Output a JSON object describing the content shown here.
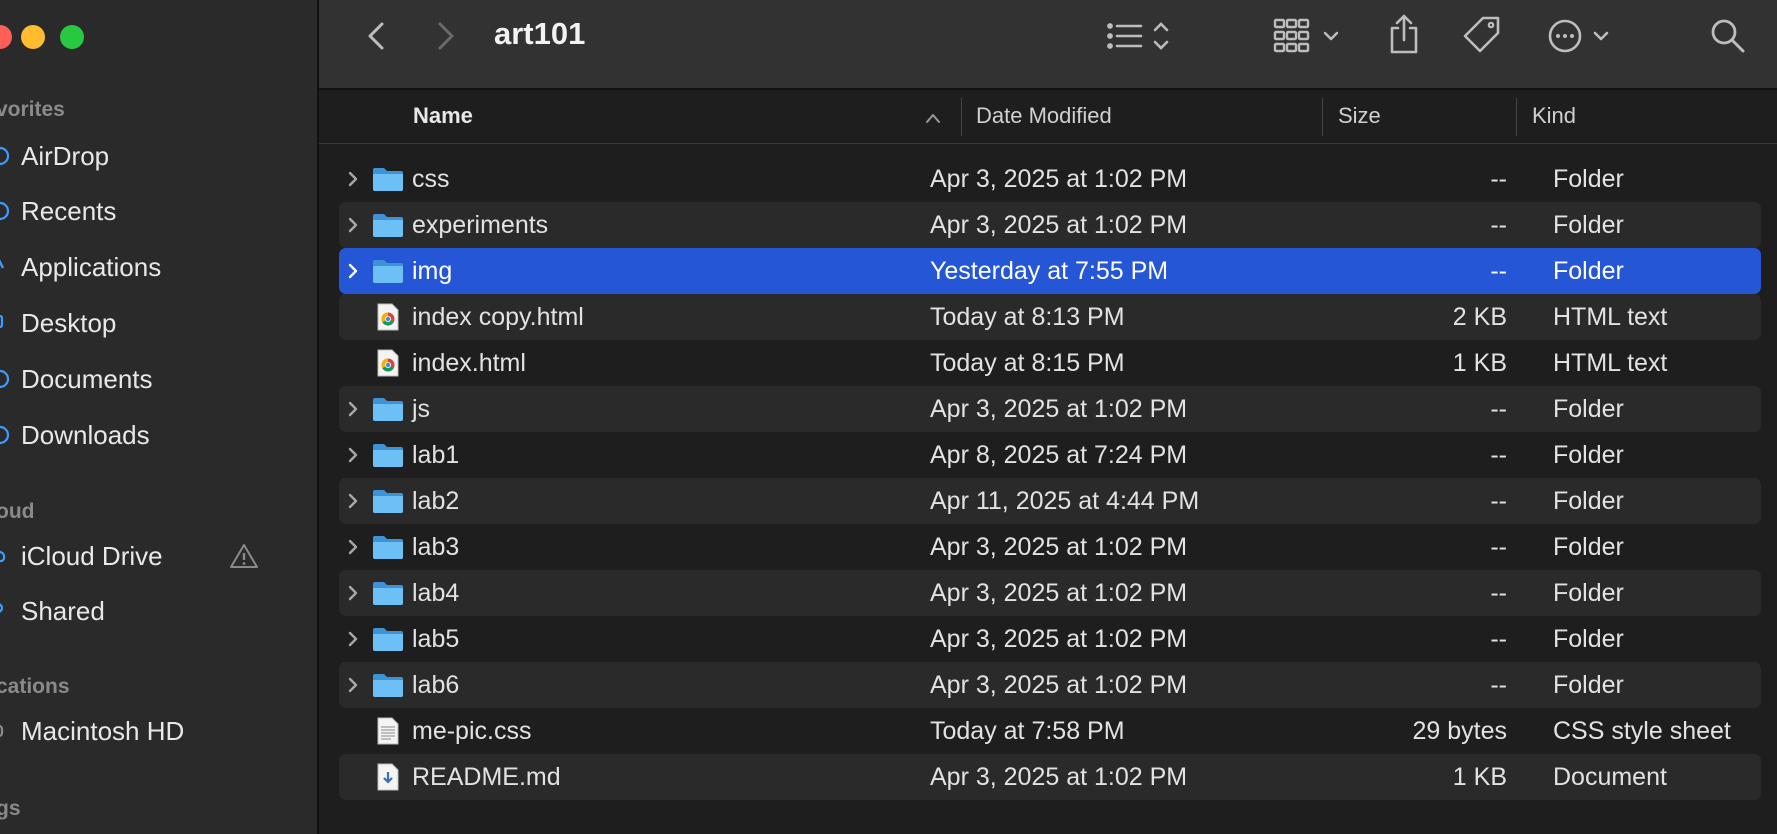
{
  "window": {
    "title": "art101"
  },
  "sidebar": {
    "sections": [
      {
        "label": "vorites",
        "items": [
          {
            "label": "AirDrop",
            "icon": "airdrop-icon"
          },
          {
            "label": "Recents",
            "icon": "clock-icon"
          },
          {
            "label": "Applications",
            "icon": "applications-icon"
          },
          {
            "label": "Desktop",
            "icon": "desktop-icon"
          },
          {
            "label": "Documents",
            "icon": "document-icon"
          },
          {
            "label": "Downloads",
            "icon": "download-icon"
          }
        ]
      },
      {
        "label": "oud",
        "items": [
          {
            "label": "iCloud Drive",
            "icon": "cloud-icon"
          },
          {
            "label": "Shared",
            "icon": "shared-folder-icon"
          }
        ]
      },
      {
        "label": "cations",
        "items": [
          {
            "label": "Macintosh HD",
            "icon": "drive-icon"
          }
        ]
      },
      {
        "label": "gs",
        "items": []
      }
    ]
  },
  "table": {
    "columns": {
      "name": "Name",
      "date": "Date Modified",
      "size": "Size",
      "kind": "Kind"
    },
    "sort": {
      "column": "name",
      "direction": "ascending"
    },
    "rows": [
      {
        "name": "css",
        "date": "Apr 3, 2025 at 1:02 PM",
        "size": "--",
        "kind": "Folder",
        "type": "folder"
      },
      {
        "name": "experiments",
        "date": "Apr 3, 2025 at 1:02 PM",
        "size": "--",
        "kind": "Folder",
        "type": "folder"
      },
      {
        "name": "img",
        "date": "Yesterday at 7:55 PM",
        "size": "--",
        "kind": "Folder",
        "type": "folder",
        "selected": true
      },
      {
        "name": "index copy.html",
        "date": "Today at 8:13 PM",
        "size": "2 KB",
        "kind": "HTML text",
        "type": "html"
      },
      {
        "name": "index.html",
        "date": "Today at 8:15 PM",
        "size": "1 KB",
        "kind": "HTML text",
        "type": "html"
      },
      {
        "name": "js",
        "date": "Apr 3, 2025 at 1:02 PM",
        "size": "--",
        "kind": "Folder",
        "type": "folder"
      },
      {
        "name": "lab1",
        "date": "Apr 8, 2025 at 7:24 PM",
        "size": "--",
        "kind": "Folder",
        "type": "folder"
      },
      {
        "name": "lab2",
        "date": "Apr 11, 2025 at 4:44 PM",
        "size": "--",
        "kind": "Folder",
        "type": "folder"
      },
      {
        "name": "lab3",
        "date": "Apr 3, 2025 at 1:02 PM",
        "size": "--",
        "kind": "Folder",
        "type": "folder"
      },
      {
        "name": "lab4",
        "date": "Apr 3, 2025 at 1:02 PM",
        "size": "--",
        "kind": "Folder",
        "type": "folder"
      },
      {
        "name": "lab5",
        "date": "Apr 3, 2025 at 1:02 PM",
        "size": "--",
        "kind": "Folder",
        "type": "folder"
      },
      {
        "name": "lab6",
        "date": "Apr 3, 2025 at 1:02 PM",
        "size": "--",
        "kind": "Folder",
        "type": "folder"
      },
      {
        "name": "me-pic.css",
        "date": "Today at 7:58 PM",
        "size": "29 bytes",
        "kind": "CSS style sheet",
        "type": "css"
      },
      {
        "name": "README.md",
        "date": "Apr 3, 2025 at 1:02 PM",
        "size": "1 KB",
        "kind": "Document",
        "type": "md"
      }
    ]
  },
  "colors": {
    "selection": "#2456d6",
    "folder": "#5ab4f0",
    "accent": "#3d9bff"
  }
}
